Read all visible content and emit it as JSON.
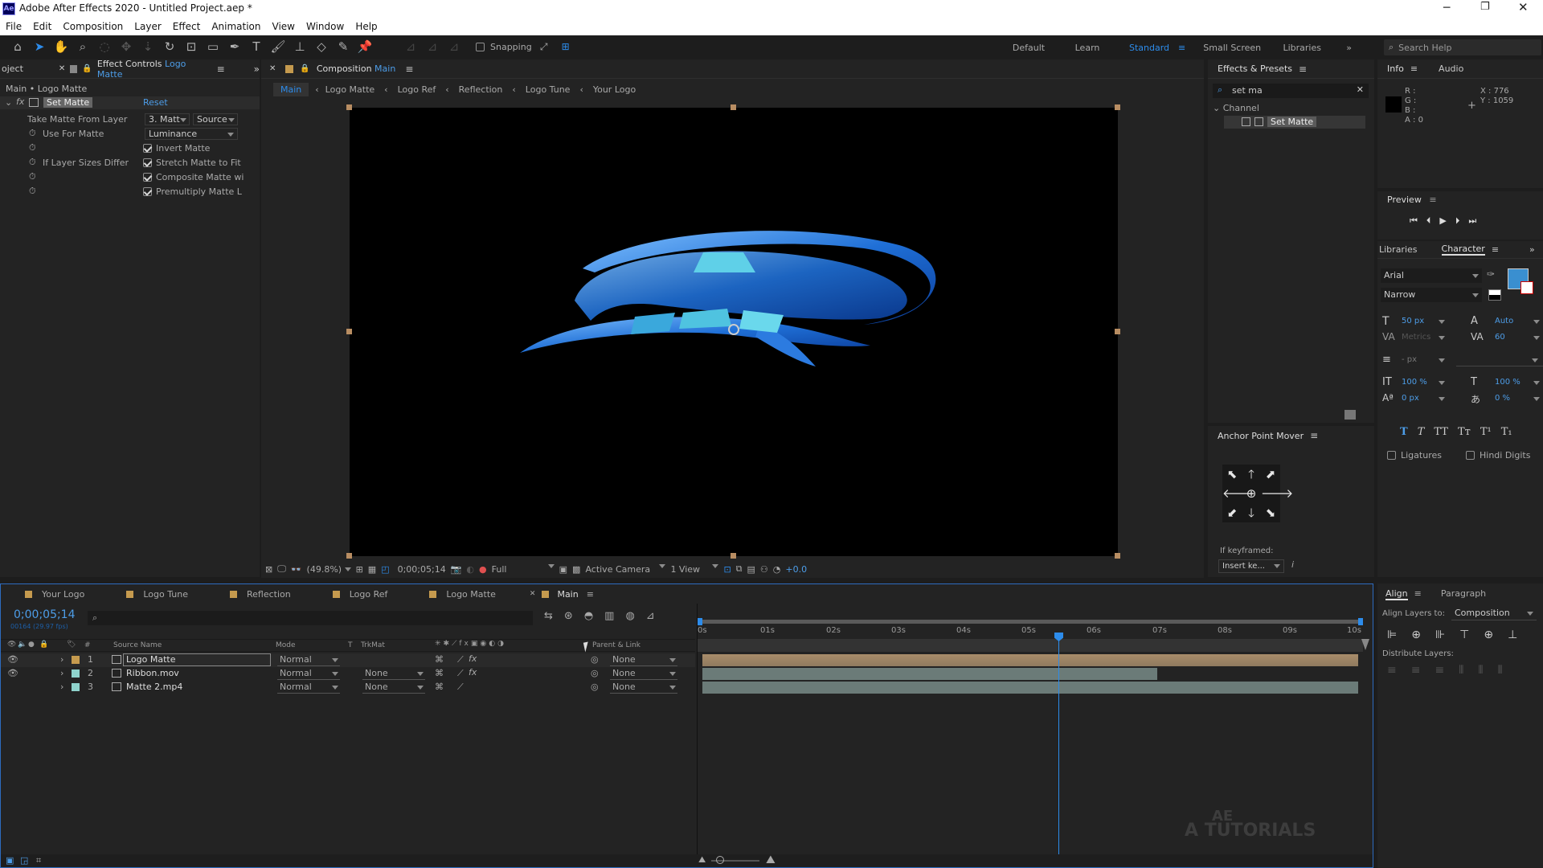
{
  "window": {
    "title": "Adobe After Effects 2020 - Untitled Project.aep *",
    "app_icon": "Ae"
  },
  "menu": [
    "File",
    "Edit",
    "Composition",
    "Layer",
    "Effect",
    "Animation",
    "View",
    "Window",
    "Help"
  ],
  "toolbar": {
    "snapping_label": "Snapping",
    "workspaces": [
      "Default",
      "Learn",
      "Standard",
      "Small Screen",
      "Libraries"
    ],
    "active_workspace": "Standard",
    "search_placeholder": "Search Help"
  },
  "effect_controls": {
    "project_tab": "oject",
    "tab_label": "Effect Controls",
    "tab_layer": "Logo Matte",
    "breadcrumb": "Main • Logo Matte",
    "effect_name": "Set Matte",
    "reset_label": "Reset",
    "rows": {
      "take_matte_label": "Take Matte From Layer",
      "take_matte_value": "3. Matt",
      "take_matte_source": "Source",
      "use_for_matte_label": "Use For Matte",
      "use_for_matte_value": "Luminance",
      "invert_label": "Invert Matte",
      "if_sizes_label": "If Layer Sizes Differ",
      "stretch_label": "Stretch Matte to Fit",
      "composite_label": "Composite Matte wi",
      "premultiply_label": "Premultiply Matte L"
    }
  },
  "composition": {
    "tab_label": "Composition",
    "tab_comp": "Main",
    "flow": [
      "Main",
      "Logo Matte",
      "Logo Ref",
      "Reflection",
      "Logo Tune",
      "Your Logo"
    ],
    "zoom": "(49.8%)",
    "timecode": "0;00;05;14",
    "resolution": "Full",
    "camera": "Active Camera",
    "views": "1 View",
    "exposure": "+0.0"
  },
  "effects_presets": {
    "title": "Effects & Presets",
    "search_value": "set ma",
    "category": "Channel",
    "item": "Set Matte"
  },
  "anchor_point": {
    "title": "Anchor Point Mover",
    "if_keyframed_label": "If keyframed:",
    "keyframe_value": "Insert ke..."
  },
  "info": {
    "tabs": [
      "Info",
      "Audio"
    ],
    "rgba_labels": [
      "R :",
      "G :",
      "B :",
      "A : 0"
    ],
    "x": "X : 776",
    "y": "Y : 1059"
  },
  "preview": {
    "title": "Preview"
  },
  "character": {
    "tabs": [
      "Libraries",
      "Character"
    ],
    "font": "Arial",
    "style": "Narrow",
    "size": "50 px",
    "leading": "Auto",
    "kerning": "Metrics",
    "tracking": "60",
    "stroke": "- px",
    "vscale": "100 %",
    "hscale": "100 %",
    "baseline": "0 px",
    "tsume": "0 %",
    "styles": [
      "T",
      "T",
      "TT",
      "Tт",
      "T¹",
      "T₁"
    ],
    "ligatures_label": "Ligatures",
    "hindi_label": "Hindi Digits",
    "fill_color": "#3a8fd0"
  },
  "align": {
    "tabs": [
      "Align",
      "Paragraph"
    ],
    "align_to_label": "Align Layers to:",
    "align_to_value": "Composition",
    "distribute_label": "Distribute Layers:"
  },
  "timeline": {
    "tabs": [
      {
        "label": "Your Logo",
        "color": "#c59a4e"
      },
      {
        "label": "Logo Tune",
        "color": "#c59a4e"
      },
      {
        "label": "Reflection",
        "color": "#c59a4e"
      },
      {
        "label": "Logo Ref",
        "color": "#c59a4e"
      },
      {
        "label": "Logo Matte",
        "color": "#c59a4e"
      },
      {
        "label": "Main",
        "color": "#c59a4e"
      }
    ],
    "timecode": "0;00;05;14",
    "fps": "00164 (29.97 fps)",
    "columns": {
      "source": "Source Name",
      "mode": "Mode",
      "t": "T",
      "trkmat": "TrkMat",
      "parent": "Parent & Link"
    },
    "layers": [
      {
        "num": "1",
        "name": "Logo Matte",
        "mode": "Normal",
        "trkmat": "",
        "parent": "None",
        "label_color": "#c59a4e"
      },
      {
        "num": "2",
        "name": "Ribbon.mov",
        "mode": "Normal",
        "trkmat": "None",
        "parent": "None",
        "label_color": "#8fd3cc"
      },
      {
        "num": "3",
        "name": "Matte 2.mp4",
        "mode": "Normal",
        "trkmat": "None",
        "parent": "None",
        "label_color": "#8fd3cc"
      }
    ],
    "ruler": [
      "0s",
      "01s",
      "02s",
      "03s",
      "04s",
      "05s",
      "06s",
      "07s",
      "08s",
      "09s",
      "10s"
    ],
    "playhead_fraction": 0.551,
    "watermark_top": "AE",
    "watermark_bottom": "TUTORIALS"
  }
}
